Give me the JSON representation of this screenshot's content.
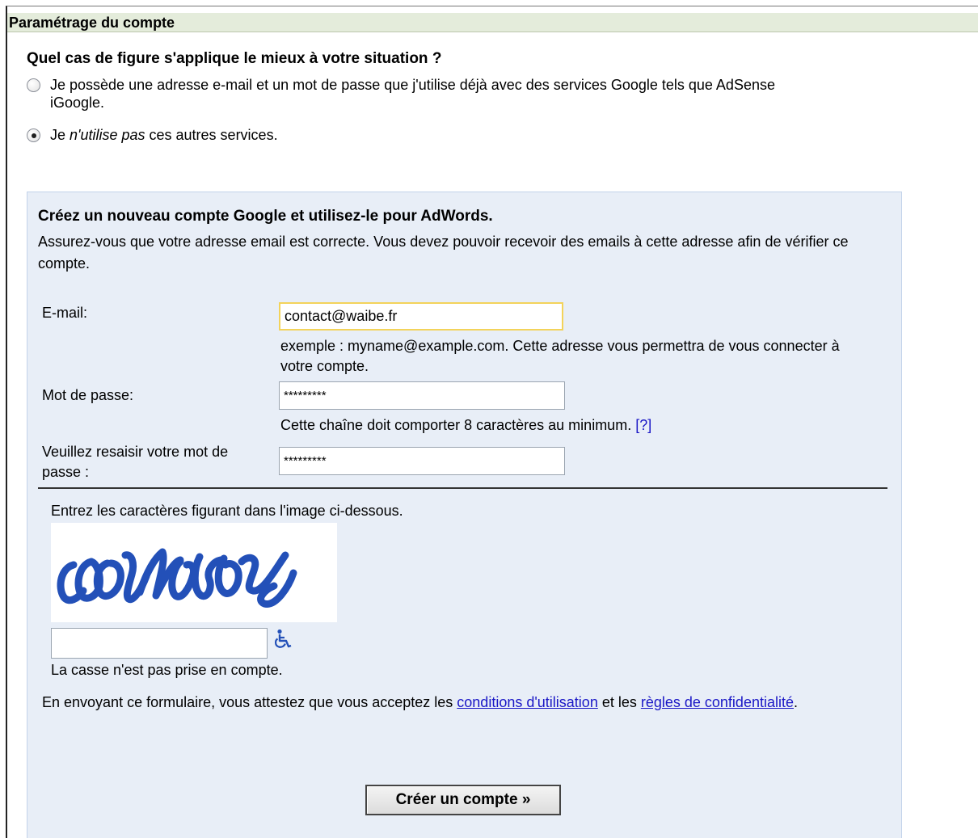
{
  "section_title": "Paramétrage du compte",
  "question": "Quel cas de figure s'applique le mieux à votre situation ?",
  "options": [
    {
      "line1": "Je possède une adresse e-mail et un mot de passe que j'utilise déjà avec des services Google tels que AdSense",
      "line2": "iGoogle.",
      "checked": false
    },
    {
      "prefix": "Je ",
      "emphasis": "n'utilise pas",
      "suffix": " ces autres services.",
      "checked": true
    }
  ],
  "panel": {
    "heading": "Créez un nouveau compte Google et utilisez-le pour AdWords.",
    "description": "Assurez-vous que votre adresse email est correcte. Vous devez pouvoir recevoir des emails à cette adresse afin de vérifier ce compte."
  },
  "email": {
    "label": "E-mail:",
    "value": "contact@waibe.fr",
    "hint": "exemple : myname@example.com. Cette adresse vous permettra de vous connecter à votre compte."
  },
  "password": {
    "label": "Mot de passe:",
    "value": "*********",
    "hint": "Cette chaîne doit comporter 8 caractères au minimum.",
    "help_link": "[?]"
  },
  "confirm_password": {
    "label": "Veuillez resaisir votre mot de passe :",
    "value": "*********"
  },
  "captcha": {
    "prompt": "Entrez les caractères figurant dans l'image ci-dessous.",
    "input_value": "",
    "case_note": "La casse n'est pas prise en compte.",
    "accessibility_icon": "wheelchair-icon"
  },
  "terms": {
    "prefix": "En envoyant ce formulaire, vous attestez que vous acceptez les ",
    "link1": "conditions d'utilisation",
    "middle": " et les ",
    "link2": "règles de confidentialité",
    "suffix": "."
  },
  "create_button": "Créer un compte »",
  "colors": {
    "title_bar": "#e4ecdb",
    "panel_bg": "#e8eef7",
    "link": "#1a17c6",
    "captcha_ink": "#2350b8",
    "email_border": "#f3d35a"
  }
}
